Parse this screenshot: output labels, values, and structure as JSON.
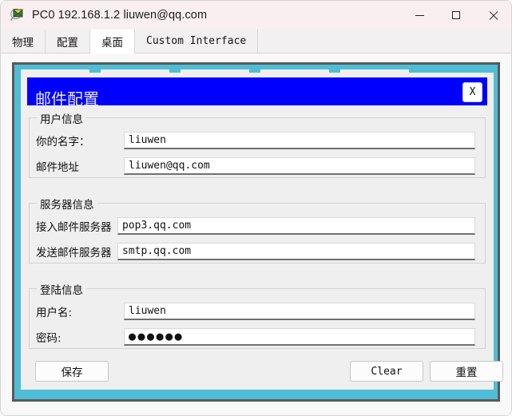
{
  "window": {
    "title": "PC0 192.168.1.2 liuwen@qq.com",
    "icon": "packet-tracer-pc-icon",
    "controls": {
      "minimize": "—",
      "maximize": "□",
      "close": "×"
    }
  },
  "tabs": [
    {
      "label": "物理",
      "active": false,
      "script": "cjk"
    },
    {
      "label": "配置",
      "active": false,
      "script": "cjk"
    },
    {
      "label": "桌面",
      "active": true,
      "script": "cjk"
    },
    {
      "label": "Custom Interface",
      "active": false,
      "script": "mono"
    }
  ],
  "desktop": {
    "background_color": "#50bdd6",
    "icon_boxes": 5
  },
  "dialog": {
    "title": "邮件配置",
    "title_bar_color": "#0000ff",
    "close_label": "X",
    "groups": [
      {
        "name": "user-info",
        "label": "用户信息",
        "fields": [
          {
            "name": "your-name",
            "label": "你的名字：",
            "value": "liuwen",
            "type": "text"
          },
          {
            "name": "email-address",
            "label": "邮件地址",
            "value": "liuwen@qq.com",
            "type": "text"
          }
        ]
      },
      {
        "name": "server-info",
        "label": "服务器信息",
        "fields": [
          {
            "name": "incoming-mail-server",
            "label": "接入邮件服务器",
            "value": "pop3.qq.com",
            "type": "text"
          },
          {
            "name": "outgoing-mail-server",
            "label": "发送邮件服务器",
            "value": "smtp.qq.com",
            "type": "text"
          }
        ]
      },
      {
        "name": "login-info",
        "label": "登陆信息",
        "fields": [
          {
            "name": "username",
            "label": "用户名:",
            "value": "liuwen",
            "type": "text"
          },
          {
            "name": "password",
            "label": "密码:",
            "value": "●●●●●●",
            "type": "password"
          }
        ]
      }
    ],
    "buttons": {
      "save": "保存",
      "clear": "Clear",
      "reset": "重置"
    }
  }
}
